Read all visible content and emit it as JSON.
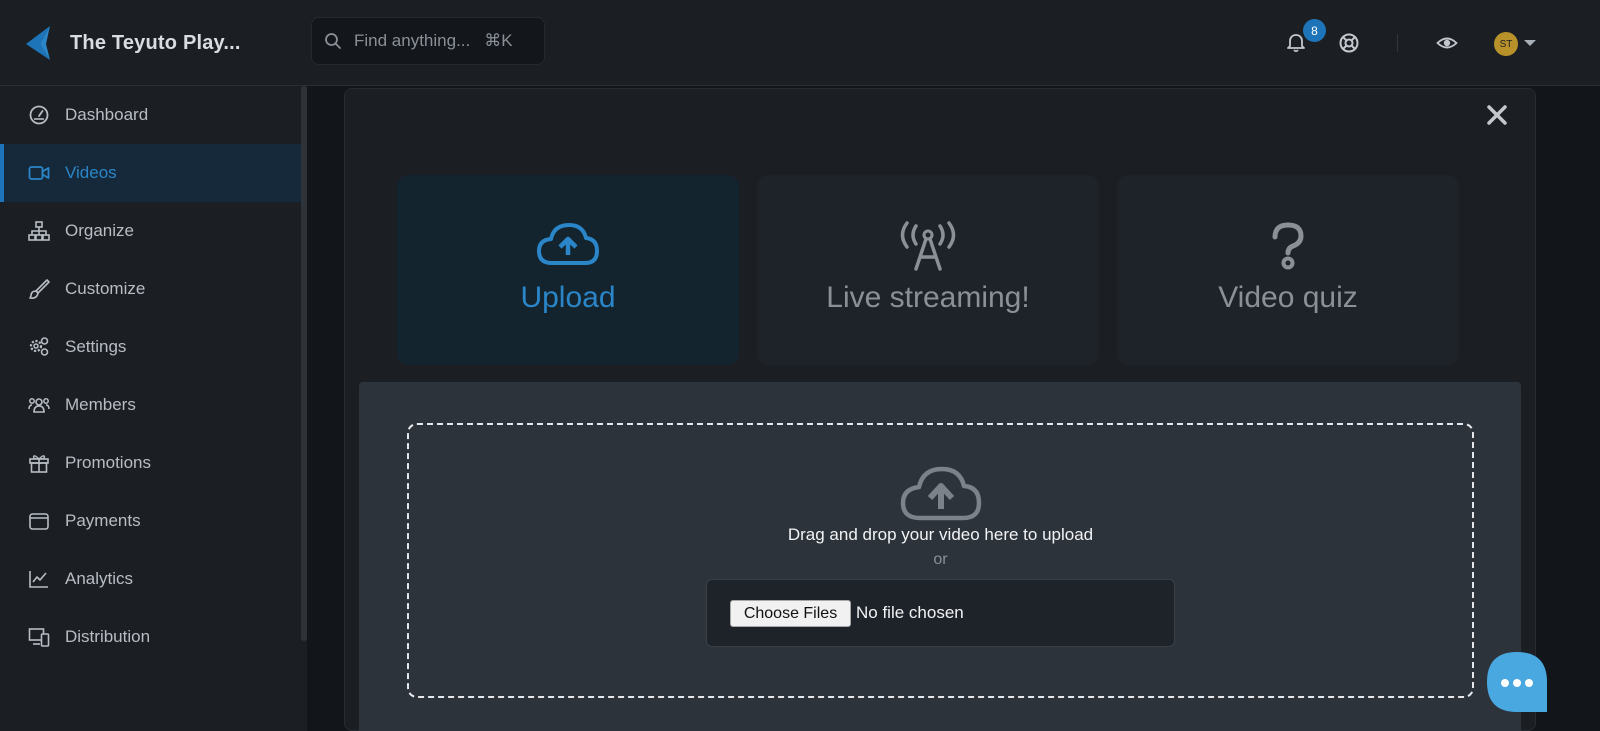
{
  "brand": {
    "name": "The Teyuto Play..."
  },
  "search": {
    "placeholder": "Find anything...",
    "shortcut": "⌘K"
  },
  "topbar": {
    "notification_count": "8",
    "avatar_initials": "ST",
    "icons": [
      "bell-icon",
      "lifebuoy-icon",
      "eye-icon",
      "chevron-down-icon"
    ]
  },
  "sidebar": {
    "items": [
      {
        "label": "Dashboard",
        "icon": "gauge-icon",
        "active": false
      },
      {
        "label": "Videos",
        "icon": "video-camera-icon",
        "active": true
      },
      {
        "label": "Organize",
        "icon": "sitemap-icon",
        "active": false
      },
      {
        "label": "Customize",
        "icon": "brush-icon",
        "active": false
      },
      {
        "label": "Settings",
        "icon": "gears-icon",
        "active": false
      },
      {
        "label": "Members",
        "icon": "users-icon",
        "active": false
      },
      {
        "label": "Promotions",
        "icon": "gift-icon",
        "active": false
      },
      {
        "label": "Payments",
        "icon": "wallet-icon",
        "active": false
      },
      {
        "label": "Analytics",
        "icon": "line-chart-icon",
        "active": false
      },
      {
        "label": "Distribution",
        "icon": "devices-icon",
        "active": false
      }
    ]
  },
  "modal": {
    "types": [
      {
        "label": "Upload",
        "icon": "cloud-upload-icon",
        "active": true
      },
      {
        "label": "Live streaming!",
        "icon": "broadcast-tower-icon",
        "active": false
      },
      {
        "label": "Video quiz",
        "icon": "question-icon",
        "active": false
      }
    ],
    "dropzone": {
      "text": "Drag and drop your video here to upload",
      "or": "or",
      "file_button": "Choose Files",
      "file_status": "No file chosen"
    }
  },
  "colors": {
    "accent": "#2a86c9",
    "badge": "#1d74b8",
    "avatar": "#b8912a",
    "chat": "#4aa8e0"
  }
}
